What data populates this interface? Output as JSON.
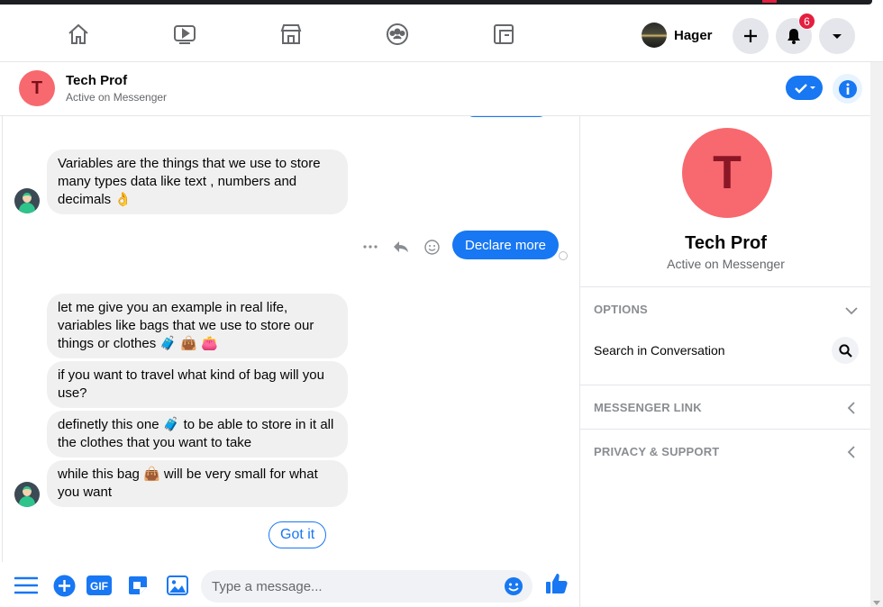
{
  "nav": {
    "user_name": "Hager",
    "notification_count": "6",
    "icons": [
      "home-icon",
      "watch-icon",
      "marketplace-icon",
      "groups-icon",
      "gaming-icon"
    ]
  },
  "chat": {
    "contact_initial": "T",
    "contact_name": "Tech Prof",
    "contact_status": "Active on Messenger",
    "messages": [
      {
        "from": "contact",
        "text": "Variables are the things that we use to store many types data like text , numbers and decimals 👌"
      },
      {
        "from": "me",
        "text": "Declare more"
      },
      {
        "from": "contact",
        "text": "let me give you an example in real life, variables like bags that we use to store our things or clothes 🧳 👜 👛"
      },
      {
        "from": "contact",
        "text": "if you want to travel what kind of bag will you use?"
      },
      {
        "from": "contact",
        "text": "definetly this one 🧳 to be able to store in it all the clothes that you want to take"
      },
      {
        "from": "contact",
        "text": "while this bag 👜 will be very small for what you want"
      }
    ],
    "quick_reply": "Got it"
  },
  "composer": {
    "placeholder": "Type a message...",
    "gif_label": "GIF"
  },
  "info": {
    "initial": "T",
    "name": "Tech Prof",
    "status": "Active on Messenger",
    "options_title": "OPTIONS",
    "search_label": "Search in Conversation",
    "messenger_link_title": "MESSENGER LINK",
    "privacy_title": "PRIVACY & SUPPORT"
  },
  "colors": {
    "accent": "#1877f2",
    "avatar_bg": "#f7696e",
    "bubble_bg": "#f0f0f0"
  }
}
